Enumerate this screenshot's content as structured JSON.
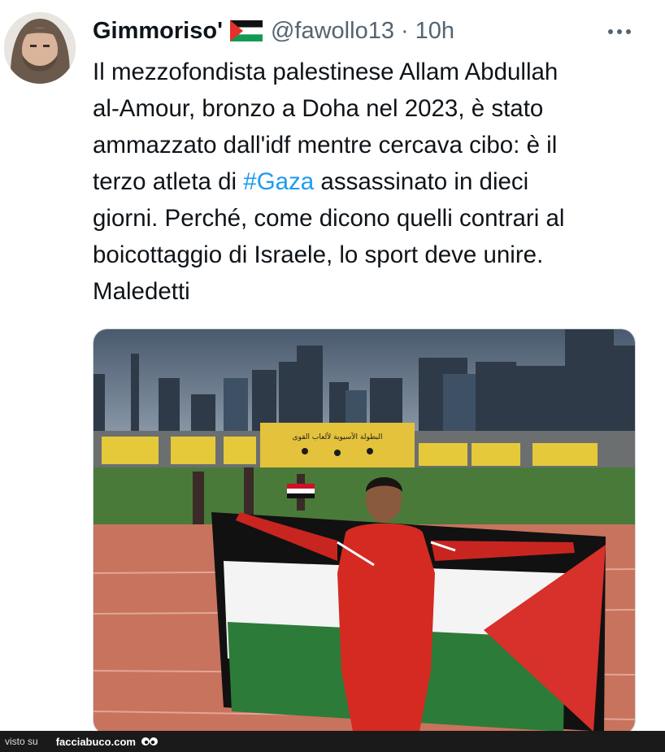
{
  "tweet": {
    "display_name": "Gimmoriso'",
    "handle": "@fawollo13",
    "separator": "·",
    "time": "10h",
    "more_label": "···",
    "text_lines": [
      [
        "Il mezzofondista palestinese Allam Abdullah"
      ],
      [
        "al-Amour, bronzo a Doha nel 2023, è stato"
      ],
      [
        "ammazzato dall'idf mentre cercava cibo: è il"
      ],
      [
        "terzo atleta di ",
        "#Gaza",
        " assassinato in dieci"
      ],
      [
        "giorni. Perché, come dicono quelli contrari al"
      ],
      [
        "boicottaggio di Israele, lo sport deve unire."
      ],
      [
        "Maledetti"
      ]
    ],
    "banner_text": "البطولة الآسيوية لألعاب القوى"
  },
  "footer": {
    "visto_label": "visto su",
    "site": "facciabuco.com"
  },
  "colors": {
    "hashtag": "#1d9bf0",
    "secondary_text": "#536471",
    "flag_red": "#e4312b",
    "flag_green": "#149954",
    "jersey_red": "#d42a22"
  }
}
